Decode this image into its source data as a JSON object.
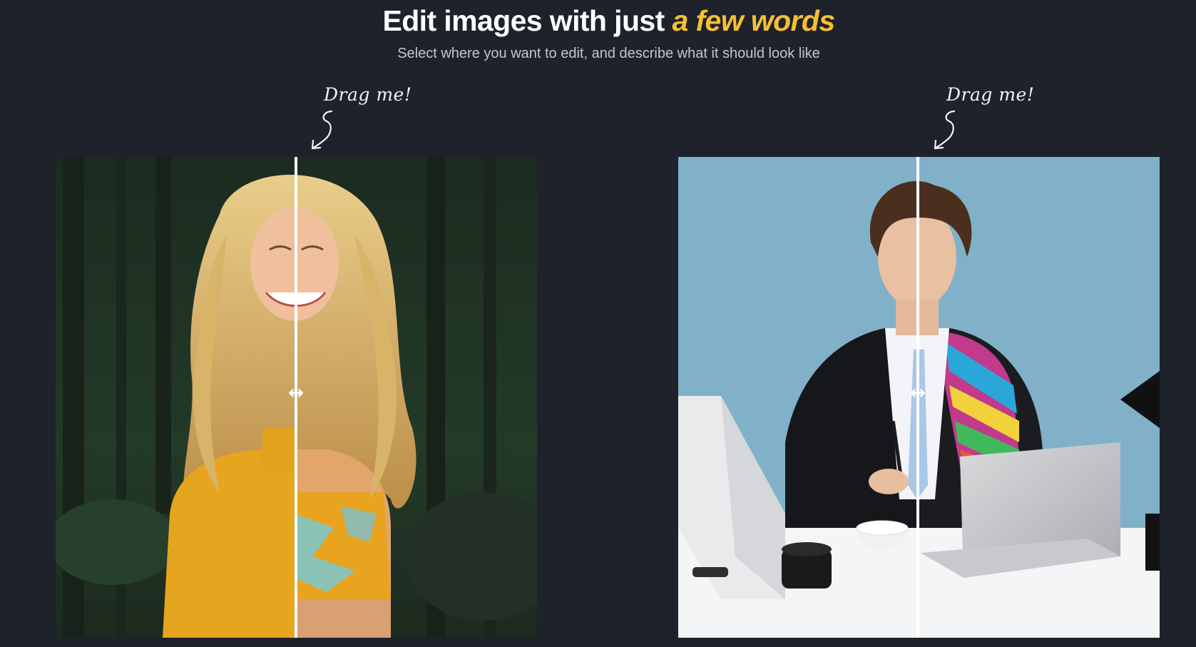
{
  "hero": {
    "title_main": "Edit images with just ",
    "title_accent": "a few words",
    "subtitle": "Select where you want to edit, and describe what it should look like"
  },
  "colors": {
    "background": "#1d222b",
    "accent": "#f6bf34",
    "subtitle": "#c2c7cf"
  },
  "comparisons": [
    {
      "hint": "Drag me!",
      "handle_icon": "↔",
      "before_scene": "woman-forest-yellow-sweater",
      "after_scene": "woman-forest-patterned-top",
      "split": 0.5
    },
    {
      "hint": "Drag me!",
      "handle_icon": "↔",
      "before_scene": "man-office-black-suit",
      "after_scene": "man-office-colorful-jacket",
      "split": 0.5
    }
  ]
}
